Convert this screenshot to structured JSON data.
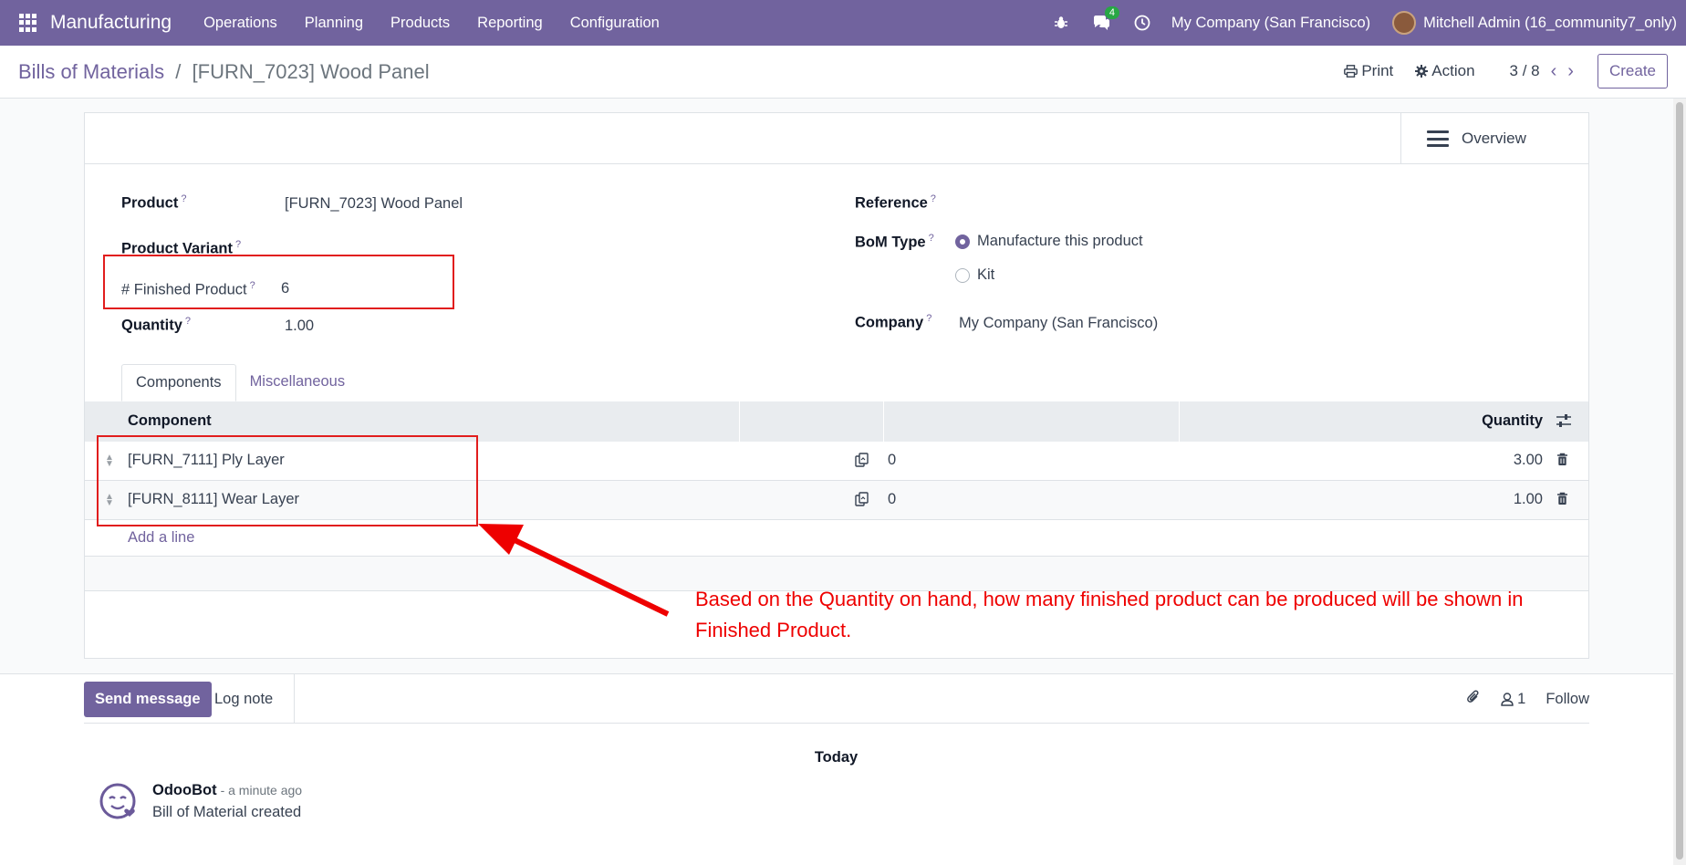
{
  "navbar": {
    "app_name": "Manufacturing",
    "menu": [
      "Operations",
      "Planning",
      "Products",
      "Reporting",
      "Configuration"
    ],
    "messages_count": "4",
    "company": "My Company (San Francisco)",
    "user": "Mitchell Admin (16_community7_only)",
    "bg_color": "#71639e"
  },
  "breadcrumb": {
    "parent": "Bills of Materials",
    "separator": "/",
    "current": "[FURN_7023] Wood Panel"
  },
  "control": {
    "print_label": "Print",
    "action_label": "Action",
    "pager": "3 / 8",
    "create_label": "Create"
  },
  "statusbar": {
    "overview_label": "Overview"
  },
  "form": {
    "product_label": "Product",
    "product_value": "[FURN_7023] Wood Panel",
    "variant_label": "Product Variant",
    "finished_label": "# Finished Product",
    "finished_value": "6",
    "quantity_label": "Quantity",
    "quantity_value": "1.00",
    "reference_label": "Reference",
    "bom_type_label": "BoM Type",
    "bom_type_options": [
      "Manufacture this product",
      "Kit"
    ],
    "company_label": "Company",
    "company_value": "My Company (San Francisco)",
    "help_mark": "?"
  },
  "tabs": [
    "Components",
    "Miscellaneous"
  ],
  "components": {
    "header_component": "Component",
    "header_quantity": "Quantity",
    "rows": [
      {
        "name": "[FURN_7111] Ply Layer",
        "avail": "0",
        "qty": "3.00"
      },
      {
        "name": "[FURN_8111] Wear Layer",
        "avail": "0",
        "qty": "1.00"
      }
    ],
    "add_line": "Add a line"
  },
  "annotation": {
    "text": "Based on the Quantity on hand, how many finished product can be produced will be shown in Finished Product.",
    "color": "#ee0000"
  },
  "chatter": {
    "send_label": "Send message",
    "log_label": "Log note",
    "followers_count": "1",
    "follow_label": "Follow",
    "today_label": "Today",
    "message": {
      "author": "OdooBot",
      "time": "- a minute ago",
      "body": "Bill of Material created"
    }
  }
}
